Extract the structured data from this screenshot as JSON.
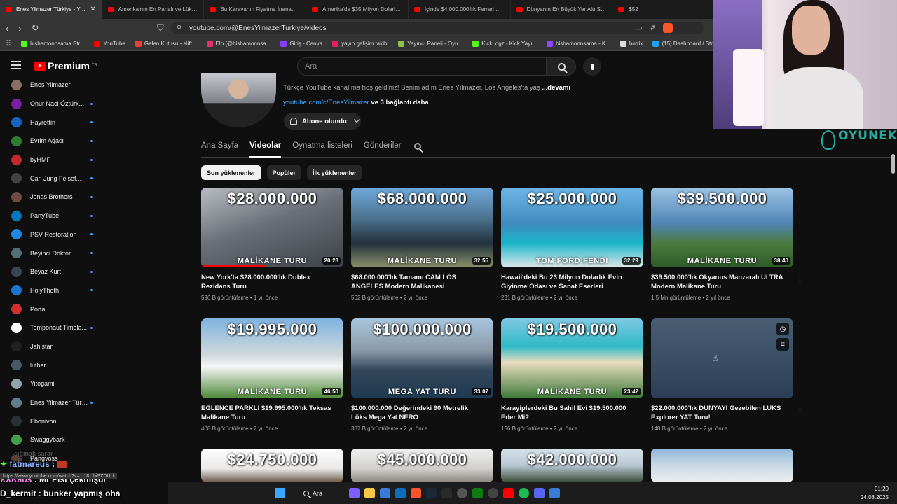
{
  "browser": {
    "tabs": [
      {
        "title": "Enes Yilmazer Türkiye - YouTube",
        "active": true
      },
      {
        "title": "Amerika'nın En Pahalı ve Lüks Dağ E",
        "active": false
      },
      {
        "title": "Bu Karavanın Fiyatına İnanamayacaks",
        "active": false
      },
      {
        "title": "Amerika'da $35 Milyon Dolarlık Mod",
        "active": false
      },
      {
        "title": "İçinde $4.000.000'lık Ferrari Garajı Ol",
        "active": false
      },
      {
        "title": "Dünyanın En Büyük Yer Altı Sığınak Ş",
        "active": false
      },
      {
        "title": "$52",
        "active": false
      }
    ],
    "url": "youtube.com/@EnesYilmazerTurkiye/videos",
    "bookmarks": [
      {
        "label": "bishamonnsama Str...",
        "color": "#53fc18"
      },
      {
        "label": "YouTube",
        "color": "#ff0000"
      },
      {
        "label": "Gelen Kutusu - eiift...",
        "color": "#ea4335"
      },
      {
        "label": "Elo (@bishamonnsa...",
        "color": "#e1306c"
      },
      {
        "label": "Giriş - Canva",
        "color": "#8b3dff"
      },
      {
        "label": "yayın gelişim takibi",
        "color": "#e91e63"
      },
      {
        "label": "Yayıncı Paneli - Oyu...",
        "color": "#8bc34a"
      },
      {
        "label": "KickLogz - Kick Yayı...",
        "color": "#53fc18"
      },
      {
        "label": "bishamonnsama - K...",
        "color": "#9146ff"
      },
      {
        "label": "botrix",
        "color": "#dddddd"
      },
      {
        "label": "(15) Dashboard / Str...",
        "color": "#1da1f2"
      }
    ]
  },
  "youtube": {
    "logo": "Premium",
    "logo_sup": "TR",
    "search_placeholder": "Ara"
  },
  "sidebar": {
    "subs": [
      {
        "name": "Enes Yilmazer",
        "color": "#8d6e63",
        "live": false
      },
      {
        "name": "Onur Naci Öztürk...",
        "color": "#7b1fa2",
        "live": true
      },
      {
        "name": "Hayrettin",
        "color": "#1565c0",
        "live": true
      },
      {
        "name": "Evrim Ağacı",
        "color": "#2e7d32",
        "live": true
      },
      {
        "name": "byHMF",
        "color": "#c62828",
        "live": true
      },
      {
        "name": "Carl Jung Felsef...",
        "color": "#424242",
        "live": true
      },
      {
        "name": "Jonas Brothers",
        "color": "#6d4c41",
        "live": true
      },
      {
        "name": "PartyTube",
        "color": "#0277bd",
        "live": true
      },
      {
        "name": "PSV Restoration",
        "color": "#1e88e5",
        "live": true
      },
      {
        "name": "Beyinci Doktor",
        "color": "#546e7a",
        "live": true
      },
      {
        "name": "Beyaz Kurt",
        "color": "#37474f",
        "live": true
      },
      {
        "name": "HolyThoth",
        "color": "#1976d2",
        "live": true
      },
      {
        "name": "Portal",
        "color": "#d32f2f",
        "live": false
      },
      {
        "name": "Temponaut Timela...",
        "color": "#fafafa",
        "live": true
      },
      {
        "name": "Jahistan",
        "color": "#212121",
        "live": false
      },
      {
        "name": "luther",
        "color": "#455a64",
        "live": false
      },
      {
        "name": "Yitogami",
        "color": "#90a4ae",
        "live": false
      },
      {
        "name": "Enes Yilmazer Türki...",
        "color": "#607d8b",
        "live": true
      },
      {
        "name": "Ebonivon",
        "color": "#263238",
        "live": false
      },
      {
        "name": "Swaggybark",
        "color": "#43a047",
        "live": false
      },
      {
        "name": "Pangvoss",
        "color": "#5d4037",
        "live": false
      }
    ]
  },
  "channel": {
    "description": "Türkçe YouTube kanalıma hoş geldiniz! Benim adım Enes Yılmazer, Los Angeles'ta yaş",
    "more": "...devamı",
    "link": "youtube.com/c/EnesYilmazer",
    "more_links": "ve 3 bağlantı daha",
    "subscribed_label": "Abone olundu",
    "tabs": [
      "Ana Sayfa",
      "Videolar",
      "Oynatma listeleri",
      "Gönderiler"
    ],
    "active_tab": 1,
    "chips": [
      "Son yüklenenler",
      "Popüler",
      "İlk yüklenenler"
    ]
  },
  "videos": [
    {
      "price": "$28.000.000",
      "caption": "MALİKANE TURU",
      "duration": "20:28",
      "title": "New York'ta $28.000.000'lık Dublex Rezidans Turu",
      "views": "596 B görüntüleme",
      "age": "1 yıl önce",
      "bg": "linear-gradient(160deg,#b8bcc2 0%,#6b7078 45%,#3d4148 100%)",
      "progress": 0.45
    },
    {
      "price": "$68.000.000",
      "caption": "MALİKANE TURU",
      "duration": "32:55",
      "title": "$68.000.000'lık Tamamı CAM LOS ANGELES Modern Malikanesi",
      "views": "562 B görüntüleme",
      "age": "2 yıl önce",
      "bg": "linear-gradient(180deg,#6fa8dc 0%,#4a6f8a 40%,#22313d 70%,#8a8f6a 100%)",
      "progress": 0
    },
    {
      "price": "$25.000.000",
      "caption": "TOM FORD   FENDI",
      "duration": "32:29",
      "title": "Hawaii'deki Bu 23 Milyon Dolarlık Evin Giyinme Odası ve Sanat Eserleri İnanılmaz!",
      "views": "231 B görüntüleme",
      "age": "2 yıl önce",
      "bg": "linear-gradient(180deg,#6fb6e6 0%,#3f8bbf 45%,#1bb6c9 70%,#dfe6e9 100%)",
      "progress": 0
    },
    {
      "price": "$39.500.000",
      "caption": "MALİKANE TURU",
      "duration": "38:40",
      "title": "$39.500.000'lık Okyanus Manzaralı ULTRA Modern Malikane Turu",
      "views": "1,5 Mn görüntüleme",
      "age": "2 yıl önce",
      "bg": "linear-gradient(180deg,#9cc3e4 0%,#4f84b4 45%,#4b7a3e 70%,#2f5a2a 100%)",
      "progress": 0
    },
    {
      "price": "$19.995.000",
      "caption": "MALİKANE TURU",
      "duration": "46:50",
      "title": "EĞLENCE PARKLI $19.995.000'lık Teksas Malikane Turu",
      "views": "408 B görüntüleme",
      "age": "2 yıl önce",
      "bg": "linear-gradient(180deg,#7fb3e0 0%,#cfd8dc 45%,#f5f5f5 60%,#4e8a3a 100%)",
      "progress": 0
    },
    {
      "price": "$100.000.000",
      "caption": "MEGA YAT TURU",
      "duration": "33:07",
      "title": "$100.000.000 Değerindeki 90 Metrelik Lüks Mega Yat NERO",
      "views": "387 B görüntüleme",
      "age": "2 yıl önce",
      "bg": "linear-gradient(180deg,#a8c6df 0%,#8a99a8 40%,#32465a 65%,#1e3a52 100%)",
      "progress": 0
    },
    {
      "price": "$19.500.000",
      "caption": "MALİKANE TURU",
      "duration": "23:42",
      "title": "Karayiplerdeki Bu Sahil Evi $19.500.000 Eder Mi?",
      "views": "156 B görüntüleme",
      "age": "2 yıl önce",
      "bg": "linear-gradient(180deg,#7ec8e3 0%,#2fb9c6 35%,#e8dcc0 55%,#3f7a3a 100%)",
      "progress": 0
    },
    {
      "price": "",
      "caption": "",
      "duration": "",
      "title": "$22.000.000'lık DÜNYAYI Gezebilen LÜKS Explorer YAT Turu!",
      "views": "148 B görüntüleme",
      "age": "2 yıl önce",
      "bg": "linear-gradient(180deg,#4a5d73 0%,#3c5068 45%,#2b3e56 100%)",
      "progress": 0
    },
    {
      "price": "$24.750.000",
      "caption": "",
      "duration": "",
      "title": "",
      "views": "",
      "age": "",
      "bg": "linear-gradient(180deg,#ffffff 0%,#e8e8e8 60%,#6a5a4a 100%)",
      "progress": 0
    },
    {
      "price": "$45.000.000",
      "caption": "",
      "duration": "",
      "title": "",
      "views": "",
      "age": "",
      "bg": "linear-gradient(180deg,#f0f0f0 0%,#d0cfcd 60%,#8c8680 100%)",
      "progress": 0
    },
    {
      "price": "$42.000.000",
      "caption": "",
      "duration": "",
      "title": "",
      "views": "",
      "age": "",
      "bg": "linear-gradient(180deg,#d7e3ea 0%,#b7c7d1 50%,#3a4d3a 100%)",
      "progress": 0
    },
    {
      "price": "",
      "caption": "",
      "duration": "",
      "title": "",
      "views": "",
      "age": "",
      "bg": "linear-gradient(180deg,#8fb6d8 0%,#c8d8e4 50%,#eeeeee 100%)",
      "progress": 0
    }
  ],
  "overlay": {
    "brand": "OYUNEKS",
    "chat": [
      {
        "user": "fatmareus",
        "msg": ":"
      },
      {
        "user": "XXKaos",
        "msg": ": Mr Pist çekmişdi"
      },
      {
        "user": "D_kermit",
        "msg": ": bunker yapmış oha"
      }
    ],
    "faded_msg": "sığınak sarar",
    "status_url": "https://www.youtube.com/watch?v=...18...hiSZDUU"
  },
  "taskbar": {
    "search_label": "Ara",
    "time": "01:20",
    "date": "24.08.2025",
    "icons": [
      {
        "name": "copilot-icon",
        "color": "#7b61ff"
      },
      {
        "name": "file-explorer-icon",
        "color": "#f9c846"
      },
      {
        "name": "store-icon",
        "color": "#3a7bd5"
      },
      {
        "name": "outlook-icon",
        "color": "#0f6cbd"
      },
      {
        "name": "brave-icon",
        "color": "#fb542b"
      },
      {
        "name": "steam-icon",
        "color": "#1b2838"
      },
      {
        "name": "epic-games-icon",
        "color": "#2a2a2a"
      },
      {
        "name": "obs-icon",
        "color": "#555555"
      },
      {
        "name": "xbox-icon",
        "color": "#107c10"
      },
      {
        "name": "chatgpt-icon",
        "color": "#444444"
      },
      {
        "name": "youtube-icon",
        "color": "#ff0000"
      },
      {
        "name": "spotify-icon",
        "color": "#1db954"
      },
      {
        "name": "discord-icon",
        "color": "#5865f2"
      },
      {
        "name": "network-icon",
        "color": "#3a7bd5"
      }
    ]
  }
}
